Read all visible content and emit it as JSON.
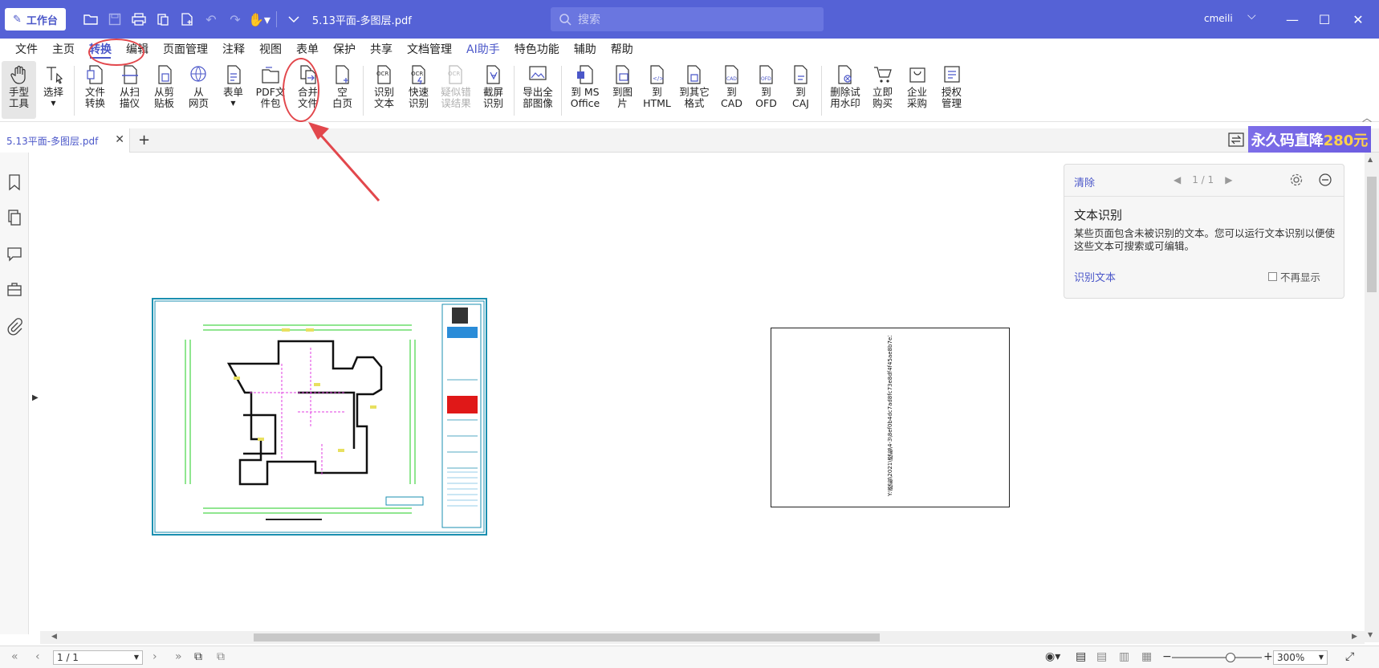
{
  "titlebar": {
    "workbench_label": "工作台",
    "doc_title": "5.13平面-多图层.pdf",
    "search_placeholder": "搜索",
    "user": "cmeili"
  },
  "menu": {
    "items": [
      "文件",
      "主页",
      "转换",
      "编辑",
      "页面管理",
      "注释",
      "视图",
      "表单",
      "保护",
      "共享",
      "文档管理",
      "AI助手",
      "特色功能",
      "辅助",
      "帮助"
    ],
    "active": "转换"
  },
  "ribbon": {
    "hand_tool": "手型\n工具",
    "select": "选择",
    "file_convert": "文件\n转换",
    "from_scanner": "从扫\n描仪",
    "from_clipboard": "从剪\n贴板",
    "from_web": "从\n网页",
    "form": "表单",
    "pdf_package": "PDF文\n件包",
    "merge_files": "合并\n文件",
    "blank_page": "空\n白页",
    "ocr_text": "识别\n文本",
    "quick_ocr": "快速\n识别",
    "suspect_errors": "疑似错\n误结果",
    "screenshot_ocr": "截屏\n识别",
    "export_images": "导出全\n部图像",
    "to_ms_office": "到 MS\nOffice",
    "to_image": "到图\n片",
    "to_html": "到\nHTML",
    "to_other": "到其它\n格式",
    "to_cad": "到\nCAD",
    "to_ofd": "到\nOFD",
    "to_caj": "到\nCAJ",
    "remove_watermark": "删除试\n用水印",
    "buy_now": "立即\n购买",
    "enterprise": "企业\n采购",
    "license": "授权\n管理"
  },
  "tabs": {
    "doc_tab": "5.13平面-多图层.pdf",
    "promo_text": "永久码直降",
    "promo_amount": "280元"
  },
  "ocr_panel": {
    "clear": "清除",
    "pager": "1 / 1",
    "title": "文本识别",
    "description": "某些页面包含未被识别的文本。您可以运行文本识别以便使这些文本可搜索或可编辑。",
    "action": "识别文本",
    "dont_show": "不再显示"
  },
  "page2": {
    "vertical_text": "Y:\\模板\\2021\\模板\\4-3\\8ef0b4dc7ad8fc73e8df4f45ae8b7e34a.jpg"
  },
  "statusbar": {
    "page": "1 / 1",
    "zoom": "300%"
  },
  "colors": {
    "accent": "#5562d6",
    "annotation_red": "#e2474c",
    "drawing_frame": "#1b8fb0"
  }
}
